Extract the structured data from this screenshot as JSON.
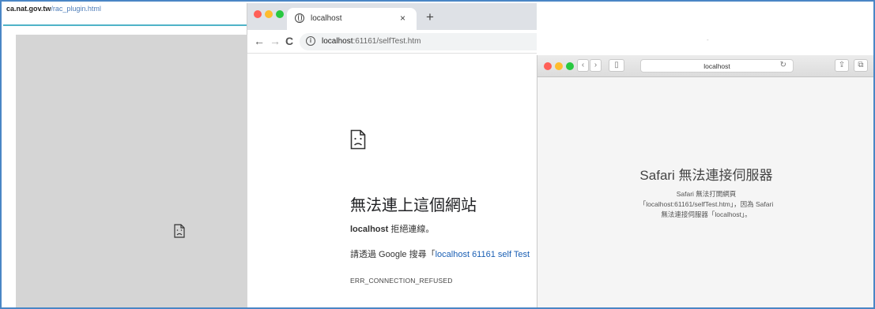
{
  "left_window": {
    "url_host": "ca.nat.gov.tw",
    "url_path": "/rac_plugin.html",
    "icon": "sad-document-icon"
  },
  "chrome": {
    "tab_title": "localhost",
    "tab_close": "×",
    "new_tab": "+",
    "back": "←",
    "forward": "→",
    "reload": "C",
    "info": "i",
    "url_host": "localhost",
    "url_rest": ":61161/selfTest.htm",
    "error_icon": "sad-document-icon",
    "error_title": "無法連上這個網站",
    "error_host": "localhost",
    "error_refused": " 拒絕連線。",
    "suggest_prefix": "請透過 Google 搜尋「",
    "suggest_link": "localhost 61161 self Test",
    "error_code": "ERR_CONNECTION_REFUSED"
  },
  "safari": {
    "top_mark": "-",
    "back": "‹",
    "forward": "›",
    "sidebar": "▯",
    "address": "localhost",
    "reload": "↻",
    "share": "⇪",
    "tabs": "⧉",
    "title": "Safari 無法連接伺服器",
    "desc_line1": "Safari 無法打開網頁",
    "desc_line2": "「localhost:61161/selfTest.htm」，因為 Safari",
    "desc_line3": "無法連接伺服器「localhost」。"
  },
  "colors": {
    "frame_border": "#4a86c5",
    "url_line": "#4fb3c8",
    "link": "#1a5fb4",
    "traffic_red": "#ff5f57",
    "traffic_yellow": "#febc2e",
    "traffic_green": "#28c840"
  }
}
